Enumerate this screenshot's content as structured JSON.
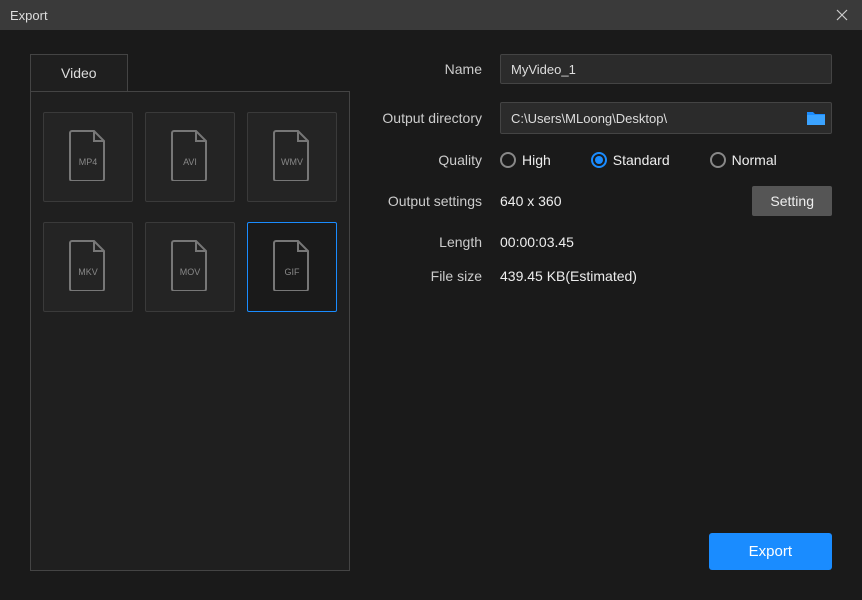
{
  "titlebar": {
    "title": "Export"
  },
  "tabs": {
    "video": "Video"
  },
  "formats": [
    {
      "label": "MP4",
      "selected": false
    },
    {
      "label": "AVI",
      "selected": false
    },
    {
      "label": "WMV",
      "selected": false
    },
    {
      "label": "MKV",
      "selected": false
    },
    {
      "label": "MOV",
      "selected": false
    },
    {
      "label": "GIF",
      "selected": true
    }
  ],
  "labels": {
    "name": "Name",
    "output_directory": "Output directory",
    "quality": "Quality",
    "output_settings": "Output settings",
    "length": "Length",
    "file_size": "File size"
  },
  "values": {
    "name": "MyVideo_1",
    "output_directory": "C:\\Users\\MLoong\\Desktop\\",
    "resolution": "640 x 360",
    "length": "00:00:03.45",
    "file_size": "439.45 KB(Estimated)"
  },
  "quality_options": [
    {
      "label": "High",
      "selected": false
    },
    {
      "label": "Standard",
      "selected": true
    },
    {
      "label": "Normal",
      "selected": false
    }
  ],
  "buttons": {
    "setting": "Setting",
    "export": "Export"
  }
}
